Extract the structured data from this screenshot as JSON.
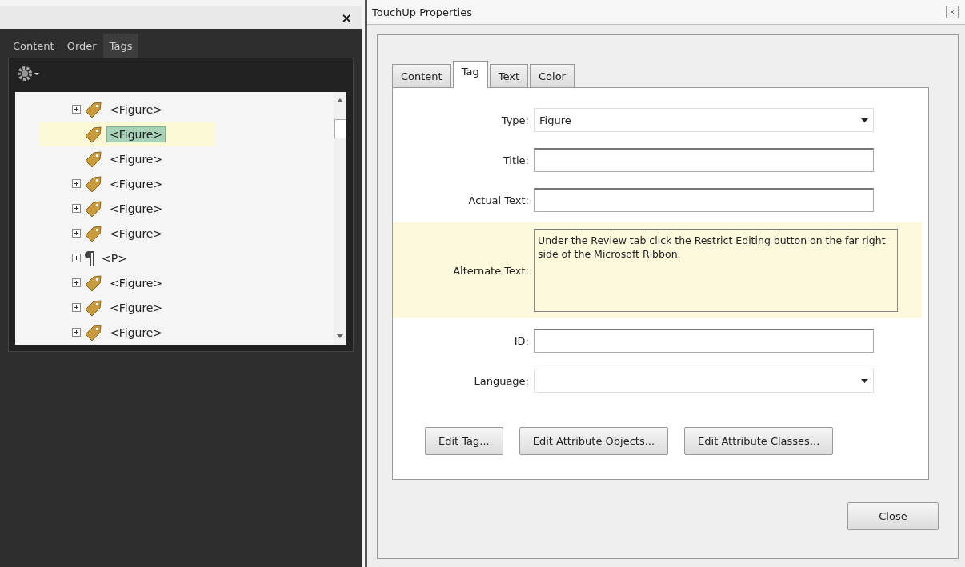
{
  "tags_panel": {
    "close": "×",
    "tabs": [
      {
        "label": "Content",
        "selected": false
      },
      {
        "label": "Order",
        "selected": false
      },
      {
        "label": "Tags",
        "selected": true
      }
    ],
    "tree": [
      {
        "label": "<Figure>",
        "kind": "tag",
        "expandable": true,
        "selected": false
      },
      {
        "label": "<Figure>",
        "kind": "tag",
        "expandable": false,
        "selected": true
      },
      {
        "label": "<Figure>",
        "kind": "tag",
        "expandable": false,
        "selected": false
      },
      {
        "label": "<Figure>",
        "kind": "tag",
        "expandable": true,
        "selected": false
      },
      {
        "label": "<Figure>",
        "kind": "tag",
        "expandable": true,
        "selected": false
      },
      {
        "label": "<Figure>",
        "kind": "tag",
        "expandable": true,
        "selected": false
      },
      {
        "label": "<P>",
        "kind": "paragraph",
        "expandable": true,
        "selected": false
      },
      {
        "label": "<Figure>",
        "kind": "tag",
        "expandable": true,
        "selected": false
      },
      {
        "label": "<Figure>",
        "kind": "tag",
        "expandable": true,
        "selected": false
      },
      {
        "label": "<Figure>",
        "kind": "tag",
        "expandable": true,
        "selected": false
      }
    ]
  },
  "dialog": {
    "title": "TouchUp Properties",
    "tabs": [
      {
        "label": "Content",
        "selected": false
      },
      {
        "label": "Tag",
        "selected": true
      },
      {
        "label": "Text",
        "selected": false
      },
      {
        "label": "Color",
        "selected": false
      }
    ],
    "fields": [
      {
        "label": "Type:",
        "kind": "dropdown",
        "value": "Figure",
        "highlighted": false
      },
      {
        "label": "Title:",
        "kind": "text",
        "highlighted": false
      },
      {
        "label": "Actual Text:",
        "kind": "text",
        "highlighted": false
      },
      {
        "label": "Alternate Text:",
        "kind": "textarea",
        "value": "Under the Review tab click the Restrict Editing button on the far right side of the Microsoft Ribbon.",
        "highlighted": true
      },
      {
        "label": "ID:",
        "kind": "text",
        "highlighted": false
      },
      {
        "label": "Language:",
        "kind": "dropdown",
        "highlighted": false
      }
    ],
    "buttons": [
      "Edit Tag...",
      "Edit Attribute Objects...",
      "Edit Attribute Classes..."
    ],
    "close_button": "Close"
  }
}
